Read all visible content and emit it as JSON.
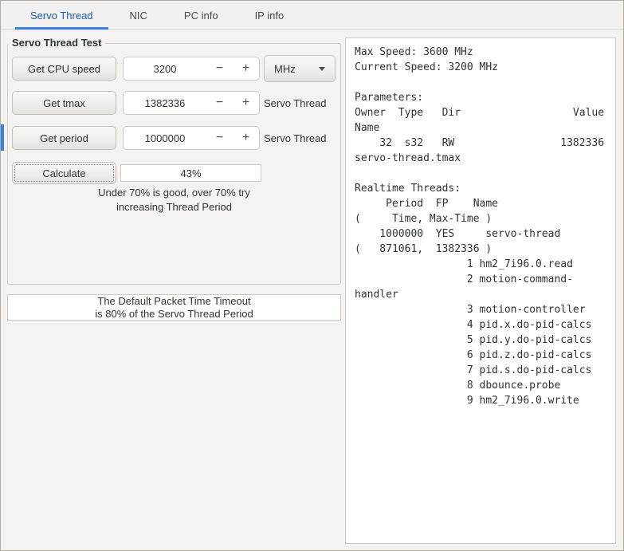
{
  "tabs": {
    "items": [
      {
        "label": "Servo Thread"
      },
      {
        "label": "NIC"
      },
      {
        "label": "PC info"
      },
      {
        "label": "IP info"
      }
    ]
  },
  "servo_test": {
    "frame_title": "Servo Thread Test",
    "rows": [
      {
        "button": "Get CPU speed",
        "value": "3200"
      },
      {
        "button": "Get tmax",
        "value": "1382336",
        "right_label": "Servo Thread"
      },
      {
        "button": "Get period",
        "value": "1000000",
        "right_label": "Servo Thread"
      }
    ],
    "spinner": {
      "minus": "−",
      "plus": "+"
    },
    "unit_dropdown": {
      "selected": "MHz"
    },
    "calculate_button": "Calculate",
    "result_value": "43%",
    "hint_line1": "Under 70% is good, over 70% try",
    "hint_line2": "increasing Thread Period"
  },
  "timeout_note": {
    "line1": "The Default Packet Time Timeout",
    "line2": "is 80% of the Servo Thread Period"
  },
  "output": {
    "text": "Max Speed: 3600 MHz\nCurrent Speed: 3200 MHz\n\nParameters:\nOwner  Type   Dir                  Value\nName\n    32  s32   RW                 1382336\nservo-thread.tmax\n\nRealtime Threads:\n     Period  FP    Name\n(     Time, Max-Time )\n    1000000  YES     servo-thread\n(   871061,  1382336 )\n                  1 hm2_7i96.0.read\n                  2 motion-command-\nhandler\n                  3 motion-controller\n                  4 pid.x.do-pid-calcs\n                  5 pid.y.do-pid-calcs\n                  6 pid.z.do-pid-calcs\n                  7 pid.s.do-pid-calcs\n                  8 dbounce.probe\n                  9 hm2_7i96.0.write"
  },
  "colors": {
    "accent": "#3584e4",
    "active_tab_text": "#1a5fb4",
    "window_bg": "#f4f3f1"
  }
}
